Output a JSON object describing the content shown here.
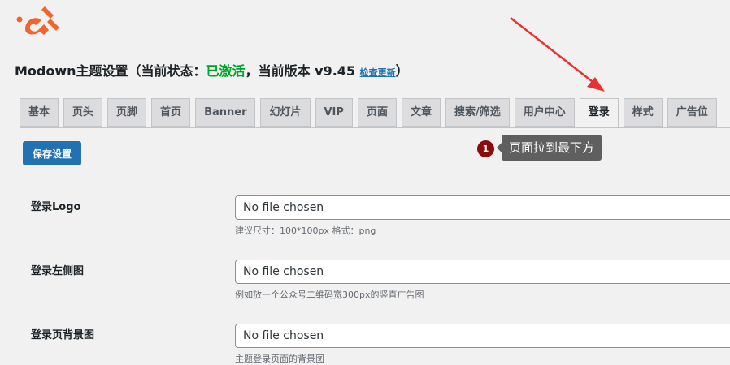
{
  "header": {
    "title_main": "Modown主题设置（当前状态：",
    "status_text": "已激活",
    "version_text": "，当前版本 v9.45",
    "update_link": "检查更新",
    "title_close": "）"
  },
  "tabs": [
    "基本",
    "页头",
    "页脚",
    "首页",
    "Banner",
    "幻灯片",
    "VIP",
    "页面",
    "文章",
    "搜索/筛选",
    "用户中心",
    "登录",
    "样式",
    "广告位"
  ],
  "active_tab": "登录",
  "save_button": "保存设置",
  "annotation": {
    "badge": "1",
    "text": "页面拉到最下方"
  },
  "fields": [
    {
      "label": "登录Logo",
      "value": "No file chosen",
      "description": "建议尺寸：100*100px 格式：png"
    },
    {
      "label": "登录左侧图",
      "value": "No file chosen",
      "description": "例如放一个公众号二维码宽300px的竖直广告图"
    },
    {
      "label": "登录页背景图",
      "value": "No file chosen",
      "description": "主题登录页面的背景图"
    }
  ],
  "colors": {
    "accent": "#2271b1",
    "logo": "#f2642a",
    "status": "#00a32a",
    "annotation_arrow": "#e8322f"
  }
}
